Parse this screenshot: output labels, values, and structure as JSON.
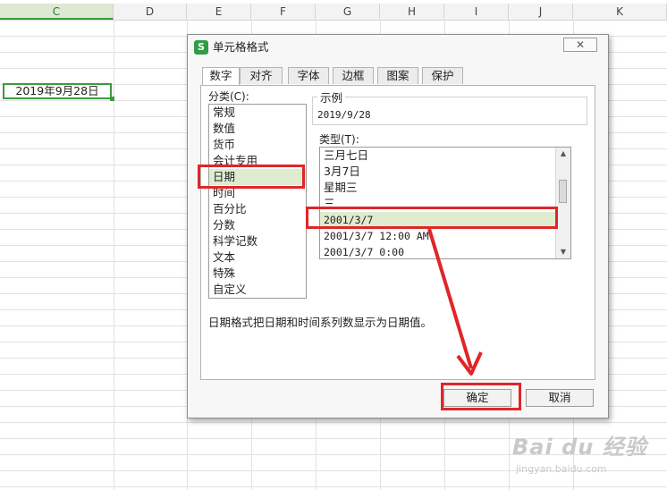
{
  "sheet": {
    "columns": [
      "C",
      "D",
      "E",
      "F",
      "G",
      "H",
      "I",
      "J",
      "K"
    ],
    "active_column": "C",
    "selected_cell_value": "2019年9月28日"
  },
  "dialog": {
    "app_icon": "S",
    "title": "单元格格式",
    "close_glyph": "✕",
    "tabs": [
      "数字",
      "对齐",
      "字体",
      "边框",
      "图案",
      "保护"
    ],
    "active_tab": "数字",
    "category_label": "分类(C):",
    "categories": [
      "常规",
      "数值",
      "货币",
      "会计专用",
      "日期",
      "时间",
      "百分比",
      "分数",
      "科学记数",
      "文本",
      "特殊",
      "自定义"
    ],
    "selected_category": "日期",
    "sample_label": "示例",
    "sample_value": "2019/9/28",
    "type_label": "类型(T):",
    "types": [
      "三月七日",
      "3月7日",
      "星期三",
      "三",
      "2001/3/7",
      "2001/3/7 12:00 AM",
      "2001/3/7 0:00"
    ],
    "selected_type": "2001/3/7",
    "description": "日期格式把日期和时间系列数显示为日期值。",
    "ok_label": "确定",
    "cancel_label": "取消"
  },
  "watermark": {
    "main": "Bai du 经验",
    "sub": "jingyan.baidu.com"
  },
  "colors": {
    "highlight": "#e0262a",
    "selection": "#dfeccf",
    "accent_green": "#3d9a3d"
  }
}
